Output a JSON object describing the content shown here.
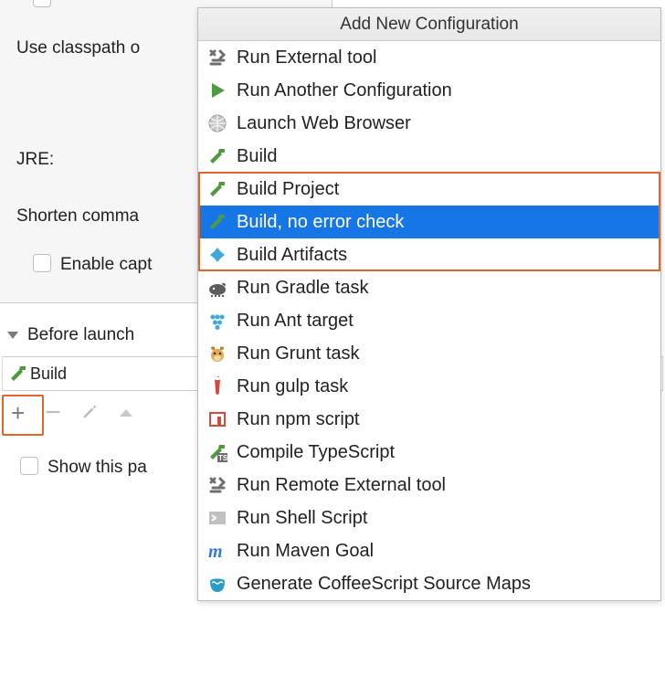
{
  "background": {
    "use_classpath_label": "Use classpath o",
    "jre_label": "JRE:",
    "shorten_label": "Shorten comma",
    "enable_capt_label": "Enable capt"
  },
  "before_launch": {
    "header": "Before launch",
    "items": [
      {
        "label": "Build"
      }
    ],
    "show_this_label": "Show this pa"
  },
  "popup": {
    "title": "Add New Configuration",
    "items": [
      {
        "icon": "tools-icon",
        "label": "Run External tool",
        "selected": false
      },
      {
        "icon": "play-icon",
        "label": "Run Another Configuration",
        "selected": false
      },
      {
        "icon": "globe-icon",
        "label": "Launch Web Browser",
        "selected": false
      },
      {
        "icon": "hammer-icon",
        "label": "Build",
        "selected": false
      },
      {
        "icon": "hammer-icon",
        "label": "Build Project",
        "selected": false
      },
      {
        "icon": "hammer-icon",
        "label": "Build, no error check",
        "selected": true
      },
      {
        "icon": "diamond-icon",
        "label": "Build Artifacts",
        "selected": false
      },
      {
        "icon": "gradle-icon",
        "label": "Run Gradle task",
        "selected": false
      },
      {
        "icon": "ant-icon",
        "label": "Run Ant target",
        "selected": false
      },
      {
        "icon": "grunt-icon",
        "label": "Run Grunt task",
        "selected": false
      },
      {
        "icon": "gulp-icon",
        "label": "Run gulp task",
        "selected": false
      },
      {
        "icon": "npm-icon",
        "label": "Run npm script",
        "selected": false
      },
      {
        "icon": "typescript-icon",
        "label": "Compile TypeScript",
        "selected": false
      },
      {
        "icon": "tools-icon",
        "label": "Run Remote External tool",
        "selected": false
      },
      {
        "icon": "shell-icon",
        "label": "Run Shell Script",
        "selected": false
      },
      {
        "icon": "maven-icon",
        "label": "Run Maven Goal",
        "selected": false
      },
      {
        "icon": "coffee-icon",
        "label": "Generate CoffeeScript Source Maps",
        "selected": false
      }
    ]
  }
}
